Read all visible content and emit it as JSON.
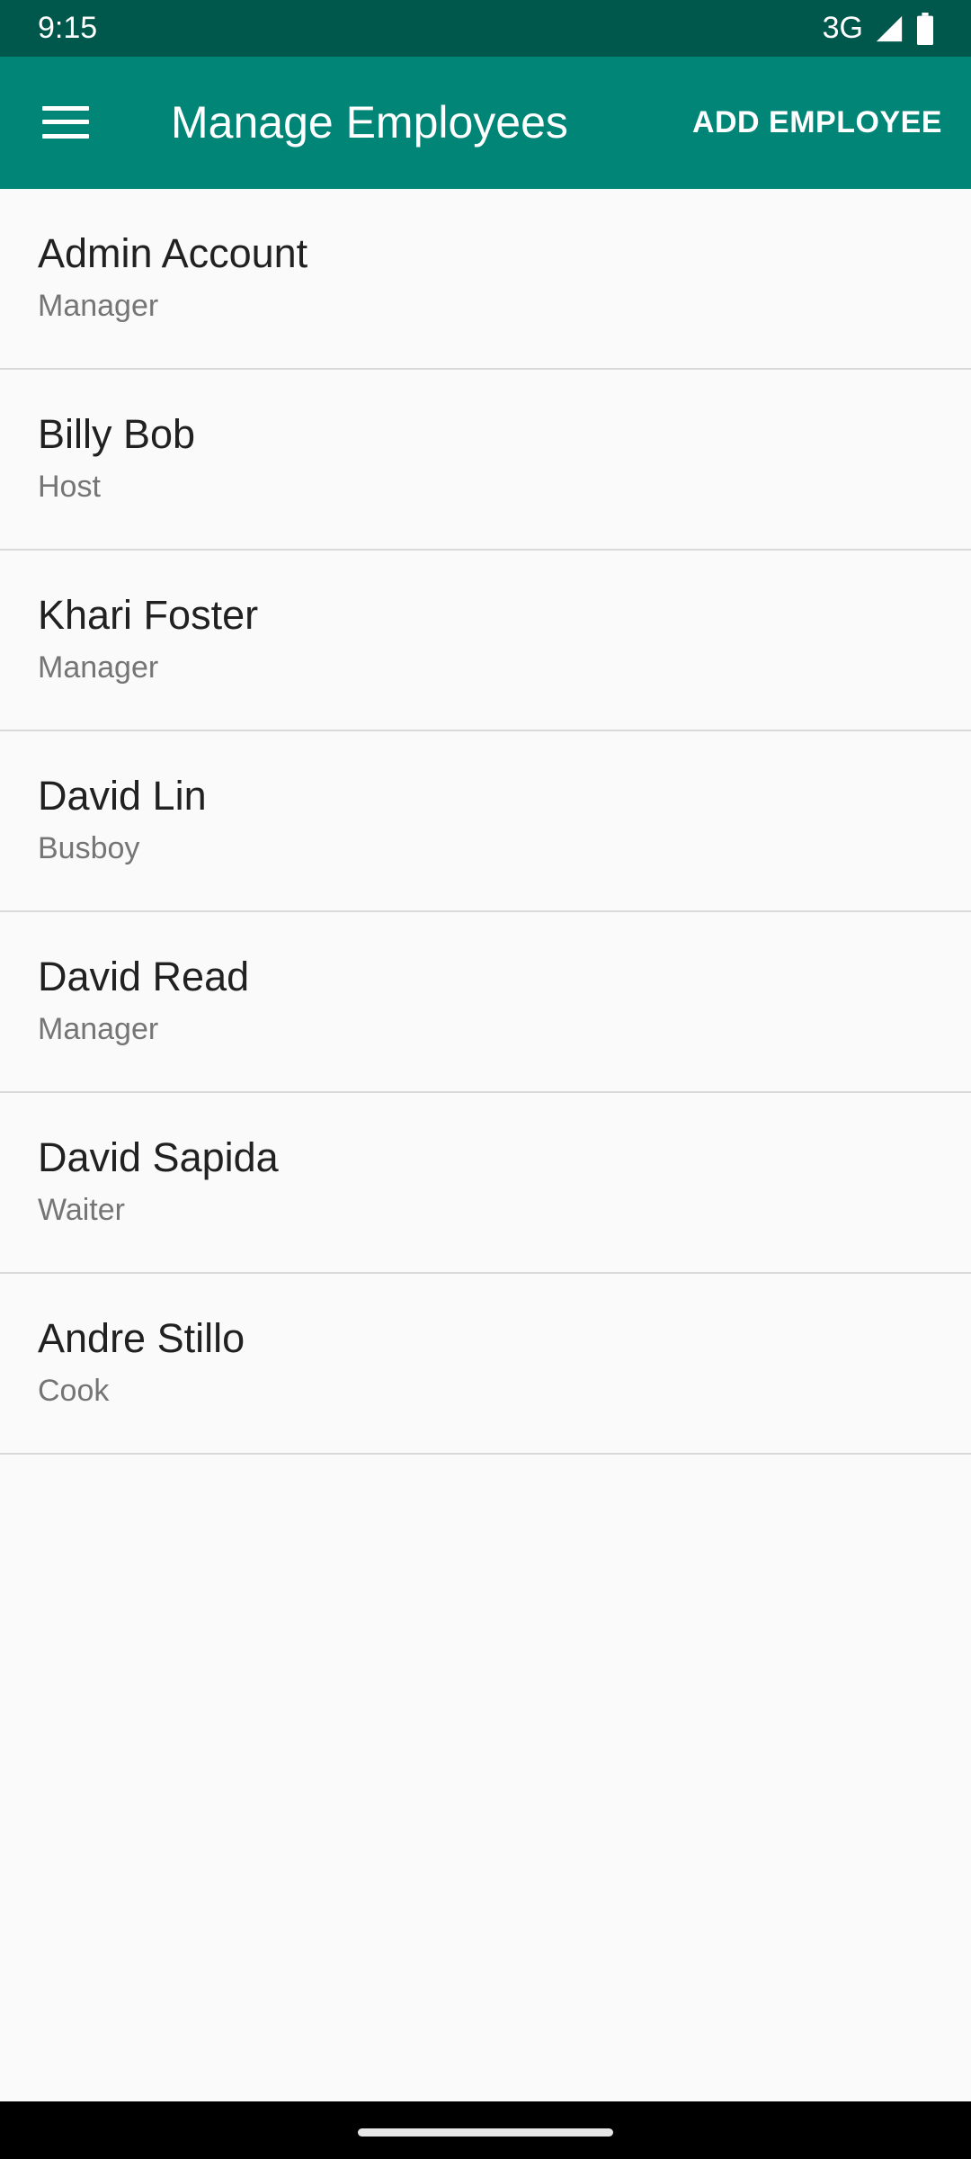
{
  "status_bar": {
    "time": "9:15",
    "network": "3G",
    "signal_icon": "signal-icon",
    "battery_icon": "battery-icon"
  },
  "app_bar": {
    "menu_icon": "menu-icon",
    "title": "Manage Employees",
    "add_employee_label": "ADD EMPLOYEE",
    "color": "#008577",
    "status_color": "#00574b"
  },
  "employees": [
    {
      "name": "Admin Account",
      "role": "Manager"
    },
    {
      "name": "Billy Bob",
      "role": "Host"
    },
    {
      "name": "Khari Foster",
      "role": "Manager"
    },
    {
      "name": "David Lin",
      "role": "Busboy"
    },
    {
      "name": "David Read",
      "role": "Manager"
    },
    {
      "name": "David Sapida",
      "role": "Waiter"
    },
    {
      "name": "Andre Stillo",
      "role": "Cook"
    }
  ]
}
